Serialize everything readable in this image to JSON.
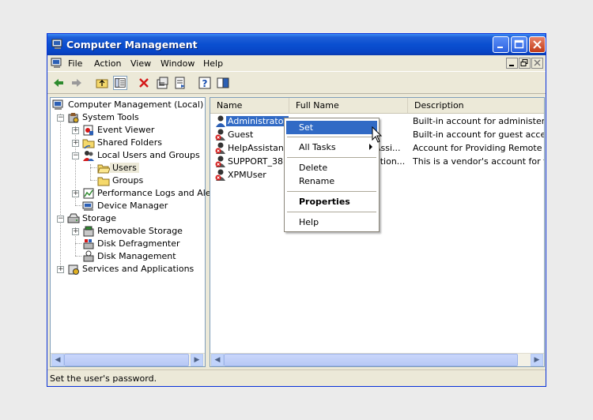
{
  "window": {
    "title": "Computer Management"
  },
  "menubar": {
    "items": [
      "File",
      "Action",
      "View",
      "Window",
      "Help"
    ]
  },
  "toolbar": {
    "icons": [
      "back-icon",
      "forward-icon",
      "up-folder-icon",
      "show-hide-tree-icon",
      "delete-icon",
      "properties-icon",
      "export-list-icon",
      "help-icon",
      "console-tree-icon"
    ]
  },
  "tree": {
    "root": "Computer Management (Local)",
    "system_tools": "System Tools",
    "event_viewer": "Event Viewer",
    "shared_folders": "Shared Folders",
    "local_users_groups": "Local Users and Groups",
    "users": "Users",
    "groups": "Groups",
    "perf_logs": "Performance Logs and Alerts",
    "device_manager": "Device Manager",
    "storage": "Storage",
    "removable_storage": "Removable Storage",
    "disk_defrag": "Disk Defragmenter",
    "disk_mgmt": "Disk Management",
    "services_apps": "Services and Applications"
  },
  "list": {
    "columns": [
      "Name",
      "Full Name",
      "Description"
    ],
    "rows": [
      {
        "name": "Administrator",
        "full": "",
        "desc": "Built-in account for administering th",
        "disabled": false
      },
      {
        "name": "Guest",
        "full": "",
        "desc": "Built-in account for guest access to",
        "disabled": true
      },
      {
        "name": "HelpAssistant",
        "full": "Assi...",
        "desc": "Account for Providing Remote Assis",
        "disabled": true
      },
      {
        "name": "SUPPORT_38...",
        "full": "ation...",
        "desc": "This is a vendor's account for the H",
        "disabled": true
      },
      {
        "name": "XPMUser",
        "full": "",
        "desc": "",
        "disabled": true
      }
    ]
  },
  "context_menu": {
    "set_password": "Set Password...",
    "all_tasks": "All Tasks",
    "delete": "Delete",
    "rename": "Rename",
    "properties": "Properties",
    "help": "Help"
  },
  "status": {
    "text": "Set the user's password."
  },
  "colors": {
    "titlebar": "#0a4fd0",
    "selection": "#316ac5",
    "pane_border": "#7f9db9"
  }
}
